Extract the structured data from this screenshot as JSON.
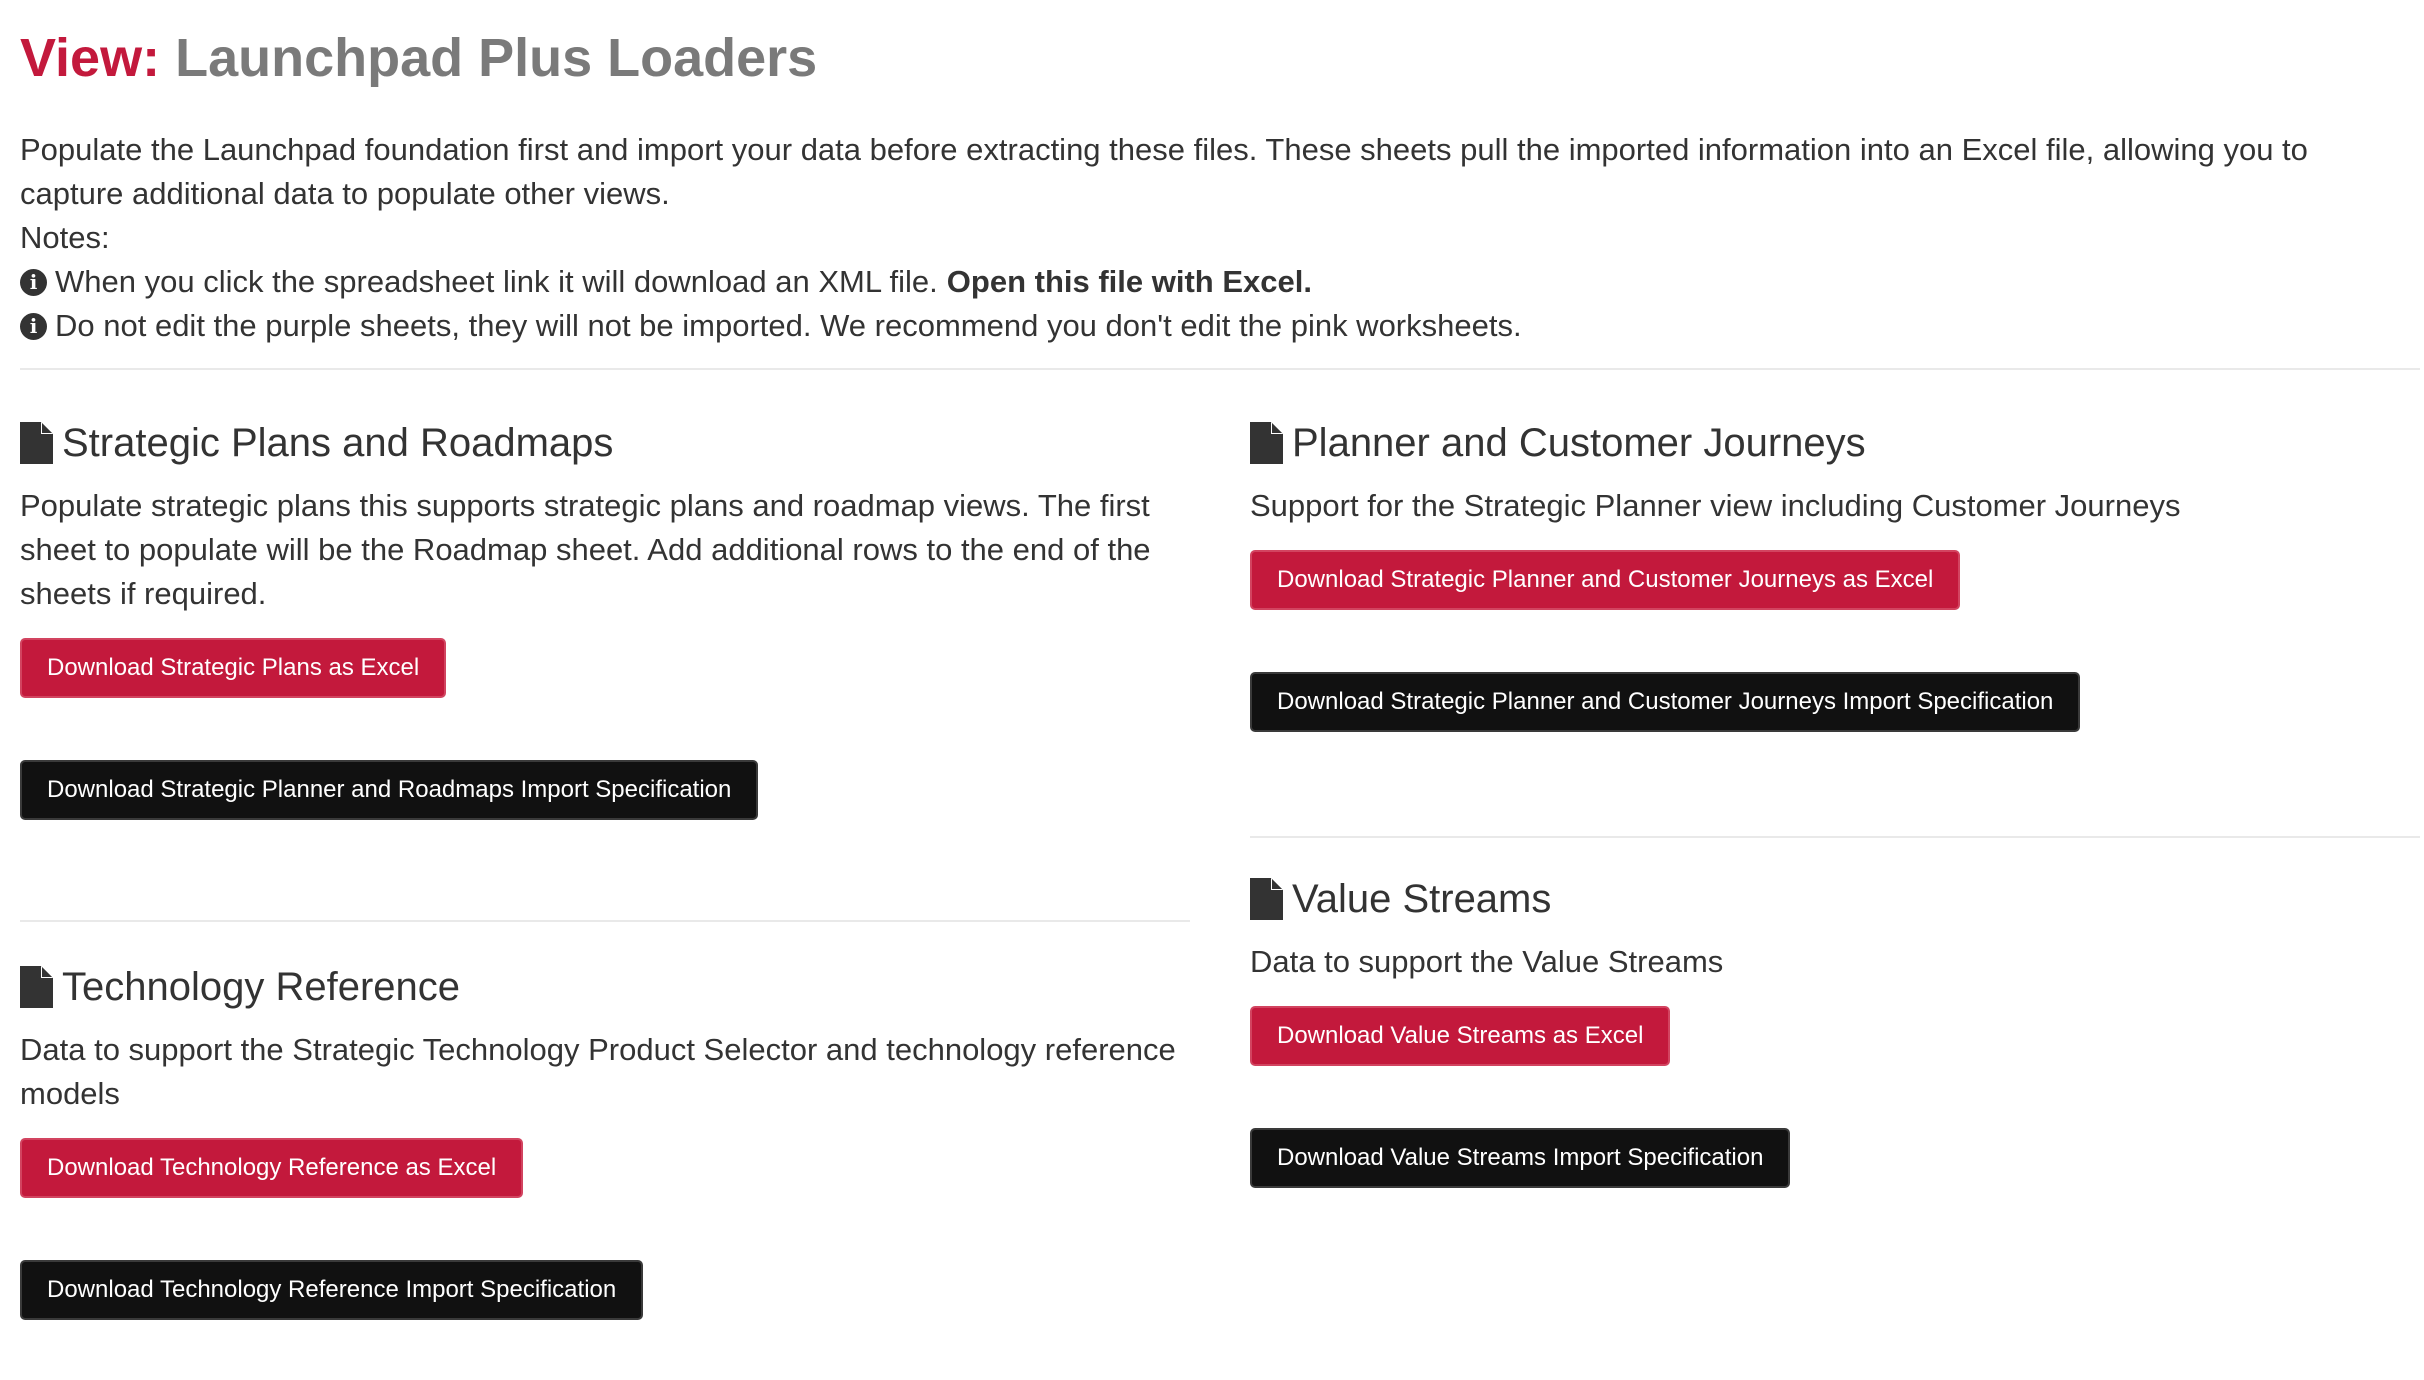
{
  "header": {
    "title_prefix": "View:",
    "title_name": "Launchpad Plus Loaders"
  },
  "intro": {
    "paragraph": "Populate the Launchpad foundation first and import your data before extracting these files. These sheets pull the imported information into an Excel file, allowing you to capture additional data to populate other views.",
    "notes_label": "Notes:",
    "note1_text": "When you click the spreadsheet link it will download an XML file.",
    "note1_bold": "Open this file with Excel.",
    "note2_text": "Do not edit the purple sheets, they will not be imported. We recommend you don't edit the pink worksheets."
  },
  "sections": {
    "strategic_plans": {
      "title": "Strategic Plans and Roadmaps",
      "description": "Populate strategic plans this supports strategic plans and roadmap views. The first sheet to populate will be the Roadmap sheet. Add additional rows to the end of the sheets if required.",
      "excel_button": "Download Strategic Plans as Excel",
      "spec_button": "Download Strategic Planner and Roadmaps Import Specification"
    },
    "technology_reference": {
      "title": "Technology Reference",
      "description": "Data to support the Strategic Technology Product Selector and technology reference models",
      "excel_button": "Download Technology Reference as Excel",
      "spec_button": "Download Technology Reference Import Specification"
    },
    "planner_journeys": {
      "title": "Planner and Customer Journeys",
      "description": "Support for the Strategic Planner view including Customer Journeys",
      "excel_button": "Download Strategic Planner and Customer Journeys as Excel",
      "spec_button": "Download Strategic Planner and Customer Journeys Import Specification"
    },
    "value_streams": {
      "title": "Value Streams",
      "description": "Data to support the Value Streams",
      "excel_button": "Download Value Streams as Excel",
      "spec_button": "Download Value Streams Import Specification"
    }
  },
  "icons": {
    "section_icon": "file-icon",
    "note_icon": "info-circle-icon"
  },
  "colors": {
    "accent": "#c3193c",
    "title_gray": "#7a7a7a",
    "dark_button": "#111111",
    "text": "#333333"
  }
}
